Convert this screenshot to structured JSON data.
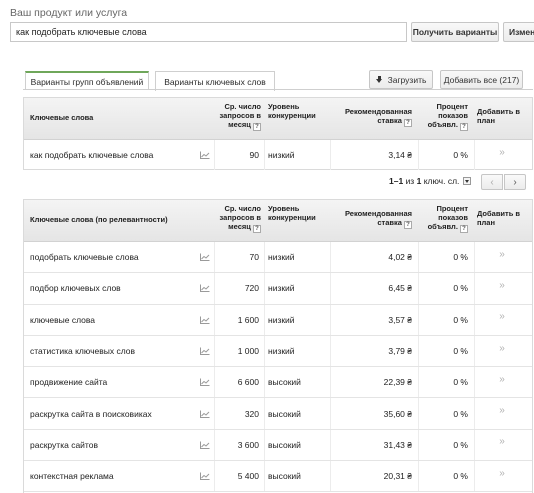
{
  "search": {
    "label": "Ваш продукт или услуга",
    "value": "как подобрать ключевые слова",
    "get_variants_label": "Получить варианты",
    "change_label": "Измен"
  },
  "tabs": {
    "groups_label": "Варианты групп объявлений",
    "keywords_label": "Варианты ключевых слов"
  },
  "toolbar": {
    "download_label": "Загрузить",
    "add_all_label": "Добавить все (217)"
  },
  "table1": {
    "headers": {
      "keyword": "Ключевые слова",
      "volume": "Ср. число запросов в месяц",
      "competition": "Уровень конкуренции",
      "bid": "Рекомендованная ставка",
      "impressions": "Процент показов объявл.",
      "add": "Добавить в план"
    },
    "rows": [
      {
        "keyword": "как подобрать ключевые слова",
        "volume": "90",
        "competition": "низкий",
        "bid": "3,14 ₴",
        "impressions": "0 %",
        "add": "»"
      }
    ]
  },
  "pager": {
    "range": "1–1",
    "of_text": "из",
    "total": "1",
    "unit": "ключ. сл."
  },
  "table2": {
    "headers": {
      "keyword": "Ключевые слова (по релевантности)",
      "volume": "Ср. число запросов в месяц",
      "competition": "Уровень конкуренции",
      "bid": "Рекомендованная ставка",
      "impressions": "Процент показов объявл.",
      "add": "Добавить в план"
    },
    "rows": [
      {
        "keyword": "подобрать ключевые слова",
        "volume": "70",
        "competition": "низкий",
        "bid": "4,02 ₴",
        "impressions": "0 %",
        "add": "»"
      },
      {
        "keyword": "подбор ключевых слов",
        "volume": "720",
        "competition": "низкий",
        "bid": "6,45 ₴",
        "impressions": "0 %",
        "add": "»"
      },
      {
        "keyword": "ключевые слова",
        "volume": "1 600",
        "competition": "низкий",
        "bid": "3,57 ₴",
        "impressions": "0 %",
        "add": "»"
      },
      {
        "keyword": "статистика ключевых слов",
        "volume": "1 000",
        "competition": "низкий",
        "bid": "3,79 ₴",
        "impressions": "0 %",
        "add": "»"
      },
      {
        "keyword": "продвижение сайта",
        "volume": "6 600",
        "competition": "высокий",
        "bid": "22,39 ₴",
        "impressions": "0 %",
        "add": "»"
      },
      {
        "keyword": "раскрутка сайта в поисковиках",
        "volume": "320",
        "competition": "высокий",
        "bid": "35,60 ₴",
        "impressions": "0 %",
        "add": "»"
      },
      {
        "keyword": "раскрутка сайтов",
        "volume": "3 600",
        "competition": "высокий",
        "bid": "31,43 ₴",
        "impressions": "0 %",
        "add": "»"
      },
      {
        "keyword": "контекстная реклама",
        "volume": "5 400",
        "competition": "высокий",
        "bid": "20,31 ₴",
        "impressions": "0 %",
        "add": "»"
      }
    ]
  }
}
